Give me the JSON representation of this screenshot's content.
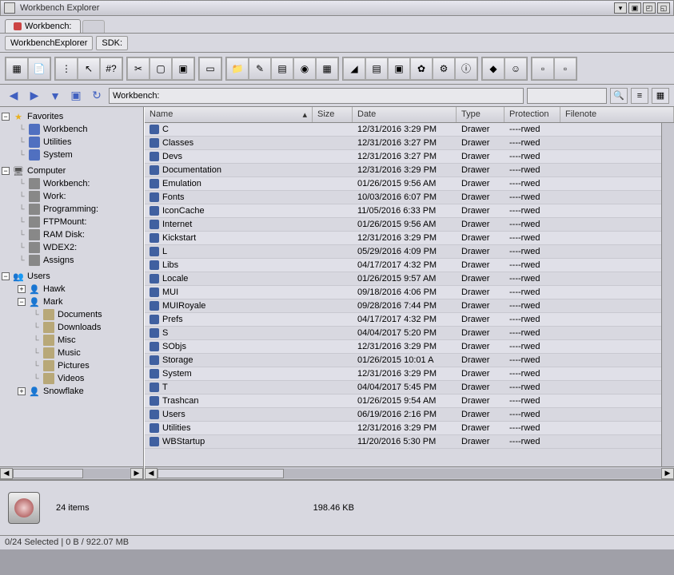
{
  "window": {
    "title": "Workbench Explorer"
  },
  "tabs": {
    "active": "Workbench:"
  },
  "buttons": {
    "explorer": "WorkbenchExplorer",
    "sdk": "SDK:"
  },
  "path": "Workbench:",
  "sidebar": {
    "favorites": {
      "label": "Favorites",
      "items": [
        "Workbench",
        "Utilities",
        "System"
      ]
    },
    "computer": {
      "label": "Computer",
      "items": [
        "Workbench:",
        "Work:",
        "Programming:",
        "FTPMount:",
        "RAM Disk:",
        "WDEX2:",
        "Assigns"
      ]
    },
    "users": {
      "label": "Users",
      "items": [
        {
          "name": "Hawk",
          "expanded": false
        },
        {
          "name": "Mark",
          "expanded": true,
          "children": [
            "Documents",
            "Downloads",
            "Misc",
            "Music",
            "Pictures",
            "Videos"
          ]
        },
        {
          "name": "Snowflake",
          "expanded": false
        }
      ]
    }
  },
  "columns": {
    "name": "Name",
    "size": "Size",
    "date": "Date",
    "type": "Type",
    "protection": "Protection",
    "filenote": "Filenote"
  },
  "files": [
    {
      "name": "C",
      "size": "",
      "date": "12/31/2016 3:29 PM",
      "type": "Drawer",
      "prot": "----rwed"
    },
    {
      "name": "Classes",
      "size": "",
      "date": "12/31/2016 3:27 PM",
      "type": "Drawer",
      "prot": "----rwed"
    },
    {
      "name": "Devs",
      "size": "",
      "date": "12/31/2016 3:27 PM",
      "type": "Drawer",
      "prot": "----rwed"
    },
    {
      "name": "Documentation",
      "size": "",
      "date": "12/31/2016 3:29 PM",
      "type": "Drawer",
      "prot": "----rwed"
    },
    {
      "name": "Emulation",
      "size": "",
      "date": "01/26/2015 9:56 AM",
      "type": "Drawer",
      "prot": "----rwed"
    },
    {
      "name": "Fonts",
      "size": "",
      "date": "10/03/2016 6:07 PM",
      "type": "Drawer",
      "prot": "----rwed"
    },
    {
      "name": "IconCache",
      "size": "",
      "date": "11/05/2016 6:33 PM",
      "type": "Drawer",
      "prot": "----rwed"
    },
    {
      "name": "Internet",
      "size": "",
      "date": "01/26/2015 9:56 AM",
      "type": "Drawer",
      "prot": "----rwed"
    },
    {
      "name": "Kickstart",
      "size": "",
      "date": "12/31/2016 3:29 PM",
      "type": "Drawer",
      "prot": "----rwed"
    },
    {
      "name": "L",
      "size": "",
      "date": "05/29/2016 4:09 PM",
      "type": "Drawer",
      "prot": "----rwed"
    },
    {
      "name": "Libs",
      "size": "",
      "date": "04/17/2017 4:32 PM",
      "type": "Drawer",
      "prot": "----rwed"
    },
    {
      "name": "Locale",
      "size": "",
      "date": "01/26/2015 9:57 AM",
      "type": "Drawer",
      "prot": "----rwed"
    },
    {
      "name": "MUI",
      "size": "",
      "date": "09/18/2016 4:06 PM",
      "type": "Drawer",
      "prot": "----rwed"
    },
    {
      "name": "MUIRoyale",
      "size": "",
      "date": "09/28/2016 7:44 PM",
      "type": "Drawer",
      "prot": "----rwed"
    },
    {
      "name": "Prefs",
      "size": "",
      "date": "04/17/2017 4:32 PM",
      "type": "Drawer",
      "prot": "----rwed"
    },
    {
      "name": "S",
      "size": "",
      "date": "04/04/2017 5:20 PM",
      "type": "Drawer",
      "prot": "----rwed"
    },
    {
      "name": "SObjs",
      "size": "",
      "date": "12/31/2016 3:29 PM",
      "type": "Drawer",
      "prot": "----rwed"
    },
    {
      "name": "Storage",
      "size": "",
      "date": "01/26/2015 10:01 A",
      "type": "Drawer",
      "prot": "----rwed"
    },
    {
      "name": "System",
      "size": "",
      "date": "12/31/2016 3:29 PM",
      "type": "Drawer",
      "prot": "----rwed"
    },
    {
      "name": "T",
      "size": "",
      "date": "04/04/2017 5:45 PM",
      "type": "Drawer",
      "prot": "----rwed"
    },
    {
      "name": "Trashcan",
      "size": "",
      "date": "01/26/2015 9:54 AM",
      "type": "Drawer",
      "prot": "----rwed"
    },
    {
      "name": "Users",
      "size": "",
      "date": "06/19/2016 2:16 PM",
      "type": "Drawer",
      "prot": "----rwed"
    },
    {
      "name": "Utilities",
      "size": "",
      "date": "12/31/2016 3:29 PM",
      "type": "Drawer",
      "prot": "----rwed"
    },
    {
      "name": "WBStartup",
      "size": "",
      "date": "11/20/2016 5:30 PM",
      "type": "Drawer",
      "prot": "----rwed"
    }
  ],
  "footer": {
    "items": "24 items",
    "size": "198.46 KB"
  },
  "status": "0/24 Selected | 0 B / 922.07 MB"
}
